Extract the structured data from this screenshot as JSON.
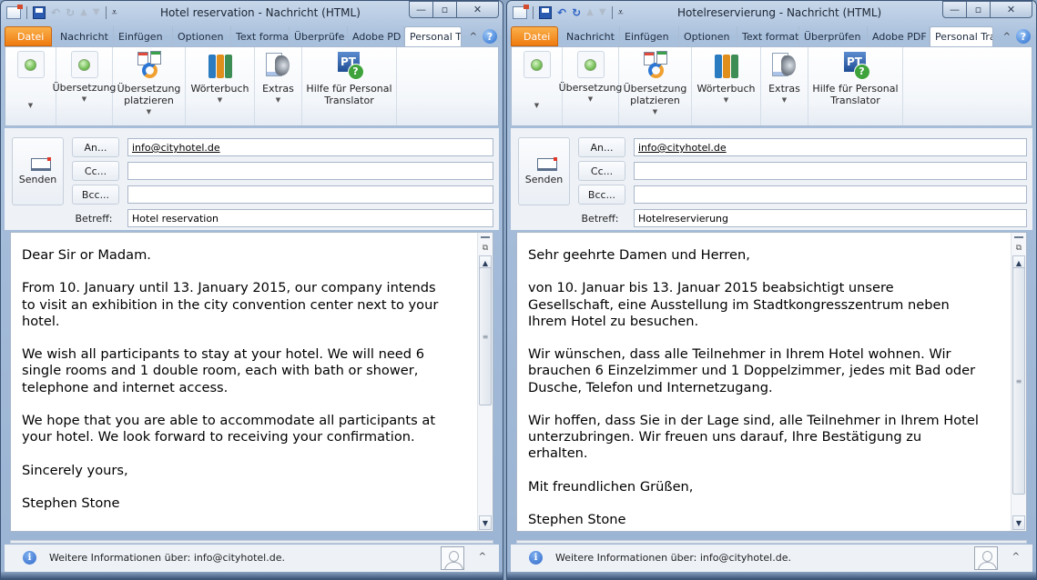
{
  "windows": [
    {
      "title": "Hotel reservation  -  Nachricht (HTML)",
      "qat": {
        "undo_enabled": false,
        "redo_enabled": false
      },
      "tabs": [
        "Datei",
        "Nachricht",
        "Einfügen",
        "Optionen",
        "Text forma",
        "Überprüfe",
        "Adobe PD",
        "Personal T"
      ],
      "active_tab": "Personal T",
      "ribbon": {
        "groups": [
          {
            "label": "",
            "icon": "status-led-icon"
          },
          {
            "label": "Übersetzung",
            "icon": "status-led-icon"
          },
          {
            "label": "Übersetzung\nplatzieren",
            "icon": "translate-place-icon"
          },
          {
            "label": "Wörterbuch",
            "icon": "dictionary-books-icon"
          },
          {
            "label": "Extras",
            "icon": "extras-speaker-icon"
          },
          {
            "label": "Hilfe für Personal\nTranslator",
            "icon": "pt-help-icon"
          }
        ]
      },
      "send_label": "Senden",
      "to_label": "An...",
      "cc_label": "Cc...",
      "bcc_label": "Bcc...",
      "subject_label": "Betreff:",
      "to_value": "info@cityhotel.de",
      "cc_value": "",
      "bcc_value": "",
      "subject_value": "Hotel reservation",
      "body": "Dear Sir or Madam.\n\nFrom 10. January until 13. January 2015, our company intends\nto visit an exhibition in the city convention center next to your\nhotel.\n\nWe wish all participants to stay at your hotel. We will need 6\nsingle rooms and 1 double room, each with bath or shower,\ntelephone and internet access.\n\nWe hope that you are able to accommodate all participants at\nyour hotel. We look forward to receiving your confirmation.\n\nSincerely yours,\n\nStephen Stone",
      "scroll_position": 0.0,
      "info_text": "Weitere Informationen über: info@cityhotel.de."
    },
    {
      "title": "Hotelreservierung  -  Nachricht (HTML)",
      "qat": {
        "undo_enabled": true,
        "redo_enabled": true
      },
      "tabs": [
        "Datei",
        "Nachricht",
        "Einfügen",
        "Optionen",
        "Text formati",
        "Überprüfen",
        "Adobe PDF",
        "Personal Tra"
      ],
      "active_tab": "Personal Tra",
      "ribbon": {
        "groups": [
          {
            "label": "",
            "icon": "status-led-icon"
          },
          {
            "label": "Übersetzung",
            "icon": "status-led-icon"
          },
          {
            "label": "Übersetzung\nplatzieren",
            "icon": "translate-place-icon"
          },
          {
            "label": "Wörterbuch",
            "icon": "dictionary-books-icon"
          },
          {
            "label": "Extras",
            "icon": "extras-speaker-icon"
          },
          {
            "label": "Hilfe für Personal\nTranslator",
            "icon": "pt-help-icon"
          }
        ]
      },
      "send_label": "Senden",
      "to_label": "An...",
      "cc_label": "Cc...",
      "bcc_label": "Bcc...",
      "subject_label": "Betreff:",
      "to_value": "info@cityhotel.de",
      "cc_value": "",
      "bcc_value": "",
      "subject_value": "Hotelreservierung",
      "body": "Sehr geehrte Damen und Herren,\n\nvon 10. Januar bis 13. Januar 2015 beabsichtigt unsere\nGesellschaft, eine Ausstellung im Stadtkongresszentrum neben\nIhrem Hotel zu besuchen.\n\nWir wünschen, dass alle Teilnehmer in Ihrem Hotel wohnen. Wir\nbrauchen 6 Einzelzimmer und 1 Doppelzimmer, jedes mit Bad oder\nDusche, Telefon und Internetzugang.\n\nWir hoffen, dass Sie in der Lage sind, alle Teilnehmer in Ihrem Hotel\nunterzubringen. Wir freuen uns darauf, Ihre Bestätigung zu\nerhalten.\n\nMit freundlichen Grüßen,\n\nStephen Stone",
      "scroll_position": 0.0,
      "info_text": "Weitere Informationen über: info@cityhotel.de."
    }
  ],
  "icons": {
    "minimize": "—",
    "maximize": "▫",
    "close": "✕",
    "help": "?",
    "ribbon_collapse": "^",
    "info": "i",
    "scroll_up": "▲",
    "scroll_down": "▼",
    "grip": "≡"
  }
}
